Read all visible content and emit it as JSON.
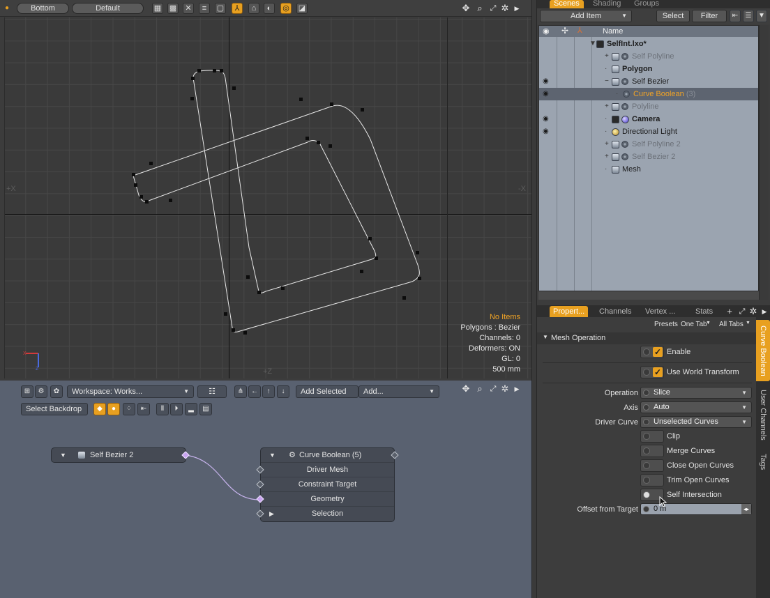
{
  "viewport": {
    "toolbar": {
      "view_label": "Bottom",
      "style_label": "Default"
    },
    "axis_labels": {
      "left": "+X",
      "right": "-X",
      "bottom": "+Z"
    },
    "info": {
      "selection": "No Items",
      "polygons": "Polygons : Bezier",
      "channels": "Channels: 0",
      "deformers": "Deformers: ON",
      "gl": "GL: 0",
      "scale": "500 mm"
    }
  },
  "schematic": {
    "workspace_label": "Workspace: Works...",
    "add_selected_label": "Add Selected",
    "add_label": "Add...",
    "select_backdrop_label": "Select Backdrop",
    "nodes": {
      "source": {
        "title": "Self Bezier 2"
      },
      "target": {
        "title": "Curve Boolean (5)",
        "inputs": [
          "Driver Mesh",
          "Constraint Target",
          "Geometry",
          "Selection"
        ]
      }
    }
  },
  "scenes": {
    "tabs": [
      "Scenes",
      "Shading",
      "Groups"
    ],
    "add_item_label": "Add Item",
    "select_label": "Select",
    "filter_label": "Filter",
    "column_name": "Name",
    "items": [
      {
        "label": "SelfInt.lxo*",
        "style": "bold",
        "indent": 0,
        "eye": false,
        "icon": "scene"
      },
      {
        "label": "Self Polyline",
        "style": "dim",
        "indent": 1,
        "eye": false,
        "icon": "mesh-gear"
      },
      {
        "label": "Polygon",
        "style": "bold",
        "indent": 1,
        "eye": false,
        "icon": "mesh"
      },
      {
        "label": "Self Bezier",
        "style": "normal",
        "indent": 1,
        "eye": true,
        "icon": "mesh-gear"
      },
      {
        "label": "Curve Boolean",
        "count": "(3)",
        "style": "orange",
        "indent": 2,
        "eye": true,
        "icon": "gear",
        "selected": true
      },
      {
        "label": "Polyline",
        "style": "dim",
        "indent": 1,
        "eye": false,
        "icon": "mesh-gear"
      },
      {
        "label": "Camera",
        "style": "bold",
        "indent": 1,
        "eye": true,
        "icon": "camera"
      },
      {
        "label": "Directional Light",
        "style": "normal",
        "indent": 1,
        "eye": true,
        "icon": "light"
      },
      {
        "label": "Self Polyline 2",
        "style": "dim",
        "indent": 1,
        "eye": false,
        "icon": "mesh-gear"
      },
      {
        "label": "Self Bezier 2",
        "style": "dim",
        "indent": 1,
        "eye": false,
        "icon": "mesh-gear"
      },
      {
        "label": "Mesh",
        "style": "normal",
        "indent": 1,
        "eye": false,
        "icon": "mesh"
      }
    ]
  },
  "properties": {
    "tabs": [
      "Propert...",
      "Channels",
      "Vertex ...",
      "Stats"
    ],
    "presets_label": "Presets",
    "one_tab_label": "One Tab",
    "all_tabs_label": "All Tabs",
    "section": "Mesh Operation",
    "enable_label": "Enable",
    "world_transform_label": "Use World Transform",
    "operation": {
      "label": "Operation",
      "value": "Slice"
    },
    "axis": {
      "label": "Axis",
      "value": "Auto"
    },
    "driver_curve": {
      "label": "Driver Curve",
      "value": "Unselected Curves"
    },
    "toggles": [
      "Clip",
      "Merge Curves",
      "Close Open Curves",
      "Trim Open Curves",
      "Self Intersection"
    ],
    "offset": {
      "label": "Offset from Target",
      "value": "0 m"
    },
    "side_tabs": [
      "Curve Boolean",
      "User Channels",
      "Tags"
    ]
  }
}
